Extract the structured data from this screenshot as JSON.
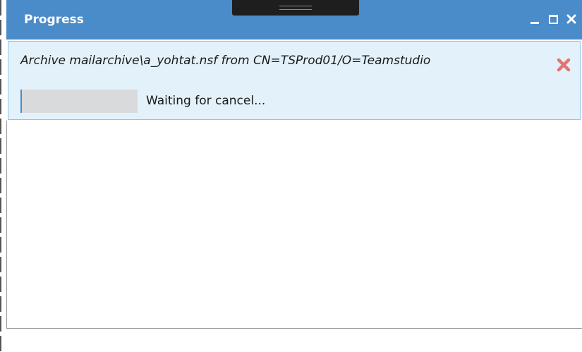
{
  "window": {
    "title": "Progress",
    "controls": {
      "minimize_icon": "minimize-icon",
      "maximize_icon": "maximize-icon",
      "close_icon": "close-icon"
    },
    "colors": {
      "titlebar": "#4a8bc9",
      "panel_background": "#e3f1fa",
      "panel_border": "#8fc4e8",
      "progress_track": "#d9dadb",
      "cancel_icon": "#e57373"
    }
  },
  "task": {
    "title": "Archive mailarchive\\a_yohtat.nsf from CN=TSProd01/O=Teamstudio",
    "status": "Waiting for cancel...",
    "progress_fraction": 0.01,
    "cancel_icon": "cancel-x-icon"
  }
}
